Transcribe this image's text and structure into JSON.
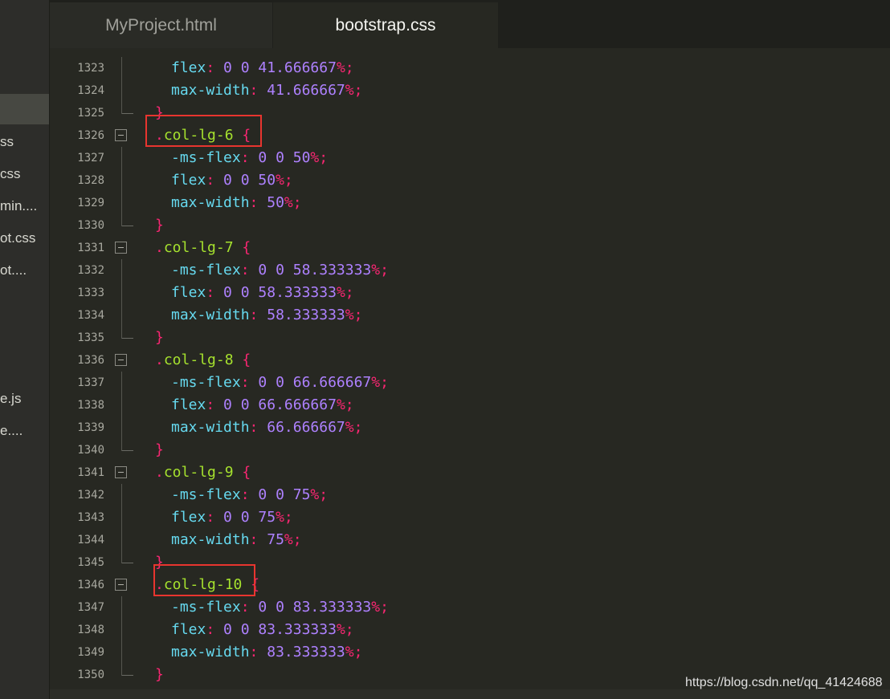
{
  "sidebar": {
    "items": [
      {
        "label": "ss"
      },
      {
        "label": "css"
      },
      {
        "label": "min...."
      },
      {
        "label": "ot.css"
      },
      {
        "label": "ot...."
      },
      {
        "label": "e.js"
      },
      {
        "label": "e...."
      }
    ]
  },
  "tabs": [
    {
      "label": "MyProject.html",
      "active": false
    },
    {
      "label": "bootstrap.css",
      "active": true
    }
  ],
  "editor": {
    "lines": [
      {
        "n": "1323",
        "prop": "flex",
        "value": "0 0 41.666667"
      },
      {
        "n": "1324",
        "prop": "max-width",
        "value": "41.666667"
      },
      {
        "n": "1325",
        "close": "}"
      },
      {
        "n": "1326",
        "selector": ".col-lg-6",
        "open": "{"
      },
      {
        "n": "1327",
        "prop": "-ms-flex",
        "value": "0 0 50"
      },
      {
        "n": "1328",
        "prop": "flex",
        "value": "0 0 50"
      },
      {
        "n": "1329",
        "prop": "max-width",
        "value": "50"
      },
      {
        "n": "1330",
        "close": "}"
      },
      {
        "n": "1331",
        "selector": ".col-lg-7",
        "open": "{"
      },
      {
        "n": "1332",
        "prop": "-ms-flex",
        "value": "0 0 58.333333"
      },
      {
        "n": "1333",
        "prop": "flex",
        "value": "0 0 58.333333"
      },
      {
        "n": "1334",
        "prop": "max-width",
        "value": "58.333333"
      },
      {
        "n": "1335",
        "close": "}"
      },
      {
        "n": "1336",
        "selector": ".col-lg-8",
        "open": "{"
      },
      {
        "n": "1337",
        "prop": "-ms-flex",
        "value": "0 0 66.666667"
      },
      {
        "n": "1338",
        "prop": "flex",
        "value": "0 0 66.666667"
      },
      {
        "n": "1339",
        "prop": "max-width",
        "value": "66.666667"
      },
      {
        "n": "1340",
        "close": "}"
      },
      {
        "n": "1341",
        "selector": ".col-lg-9",
        "open": "{"
      },
      {
        "n": "1342",
        "prop": "-ms-flex",
        "value": "0 0 75"
      },
      {
        "n": "1343",
        "prop": "flex",
        "value": "0 0 75"
      },
      {
        "n": "1344",
        "prop": "max-width",
        "value": "75"
      },
      {
        "n": "1345",
        "close": "}"
      },
      {
        "n": "1346",
        "selector": ".col-lg-10",
        "open": "{"
      },
      {
        "n": "1347",
        "prop": "-ms-flex",
        "value": "0 0 83.333333"
      },
      {
        "n": "1348",
        "prop": "flex",
        "value": "0 0 83.333333"
      },
      {
        "n": "1349",
        "prop": "max-width",
        "value": "83.333333"
      },
      {
        "n": "1350",
        "close": "}"
      }
    ],
    "highlighted_selectors": [
      ".col-lg-6",
      ".col-lg-10"
    ]
  },
  "colors": {
    "background": "#272822",
    "property": "#66d9ef",
    "punctuation": "#f92672",
    "number": "#ae81ff",
    "selector": "#a6e22e",
    "highlight_box": "#e8352f"
  },
  "watermark": "https://blog.csdn.net/qq_41424688"
}
